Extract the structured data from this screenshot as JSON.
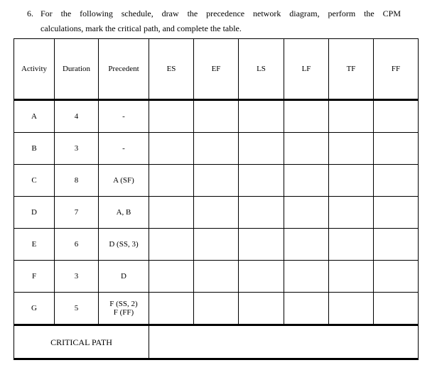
{
  "question": {
    "number": "6.",
    "line1": "For the following schedule, draw the precedence network diagram, perform the CPM",
    "line2": "calculations, mark the critical path, and complete the table."
  },
  "table": {
    "headers": [
      "Activity",
      "Duration",
      "Precedent",
      "ES",
      "EF",
      "LS",
      "LF",
      "TF",
      "FF"
    ],
    "rows": [
      {
        "activity": "A",
        "duration": "4",
        "precedent": [
          "-"
        ],
        "es": "",
        "ef": "",
        "ls": "",
        "lf": "",
        "tf": "",
        "ff": ""
      },
      {
        "activity": "B",
        "duration": "3",
        "precedent": [
          "-"
        ],
        "es": "",
        "ef": "",
        "ls": "",
        "lf": "",
        "tf": "",
        "ff": ""
      },
      {
        "activity": "C",
        "duration": "8",
        "precedent": [
          "A (SF)"
        ],
        "es": "",
        "ef": "",
        "ls": "",
        "lf": "",
        "tf": "",
        "ff": ""
      },
      {
        "activity": "D",
        "duration": "7",
        "precedent": [
          "A, B"
        ],
        "es": "",
        "ef": "",
        "ls": "",
        "lf": "",
        "tf": "",
        "ff": ""
      },
      {
        "activity": "E",
        "duration": "6",
        "precedent": [
          "D (SS, 3)"
        ],
        "es": "",
        "ef": "",
        "ls": "",
        "lf": "",
        "tf": "",
        "ff": ""
      },
      {
        "activity": "F",
        "duration": "3",
        "precedent": [
          "D"
        ],
        "es": "",
        "ef": "",
        "ls": "",
        "lf": "",
        "tf": "",
        "ff": ""
      },
      {
        "activity": "G",
        "duration": "5",
        "precedent": [
          "F (SS, 2)",
          "F (FF)"
        ],
        "es": "",
        "ef": "",
        "ls": "",
        "lf": "",
        "tf": "",
        "ff": ""
      }
    ],
    "critical_path_label": "CRITICAL PATH",
    "critical_path_value": ""
  }
}
